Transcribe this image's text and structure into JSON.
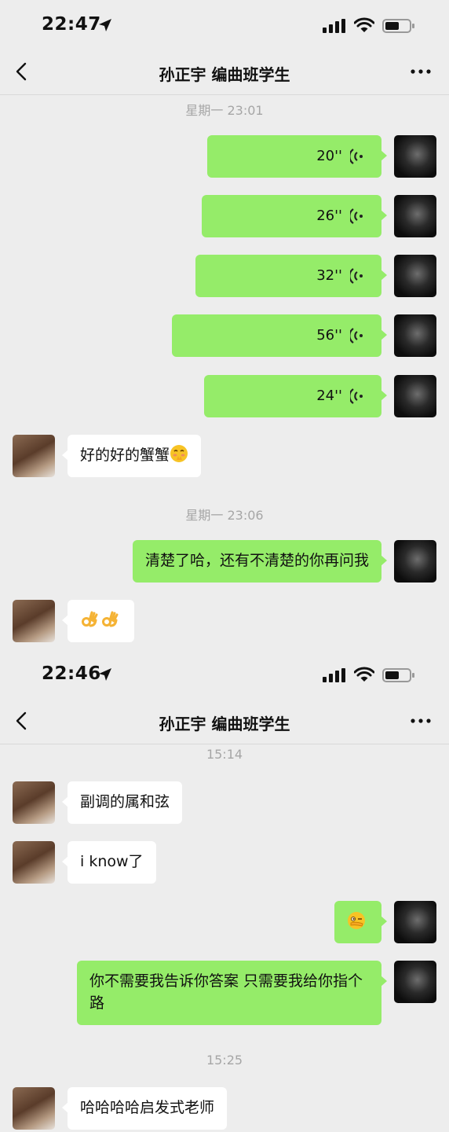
{
  "screens": [
    {
      "status": {
        "time": "22:47"
      },
      "header": {
        "title": "孙正宇 编曲班学生",
        "back_icon": "chevron-left-icon",
        "more_icon": "more-icon"
      },
      "timestamps": [
        "星期一 23:01",
        "星期一 23:06"
      ],
      "voice_messages": [
        {
          "duration": "20''"
        },
        {
          "duration": "26''"
        },
        {
          "duration": "32''"
        },
        {
          "duration": "56''"
        },
        {
          "duration": "24''"
        }
      ],
      "msg_reply_1": {
        "text": "好的好的蟹蟹",
        "emoji": "shy-face-emoji"
      },
      "msg_me_1": {
        "text": "清楚了哈，还有不清楚的你再问我"
      },
      "msg_reply_2": {
        "emojis": [
          "ok-hand-emoji",
          "ok-hand-emoji"
        ]
      }
    },
    {
      "status": {
        "time": "22:46"
      },
      "header": {
        "title": "孙正宇 编曲班学生",
        "back_icon": "chevron-left-icon",
        "more_icon": "more-icon"
      },
      "timestamps": [
        "15:14",
        "15:25"
      ],
      "msg_1": {
        "text": "副调的属和弦"
      },
      "msg_2": {
        "text": "i know了"
      },
      "msg_3": {
        "emoji": "peek-face-emoji"
      },
      "msg_4": {
        "text": "你不需要我告诉你答案 只需要我给你指个路"
      },
      "msg_5": {
        "text": "哈哈哈哈启发式老师"
      }
    }
  ],
  "colors": {
    "background": "#ededed",
    "my_bubble": "#95ec69",
    "their_bubble": "#ffffff",
    "timestamp_text": "#a6a6a6"
  }
}
